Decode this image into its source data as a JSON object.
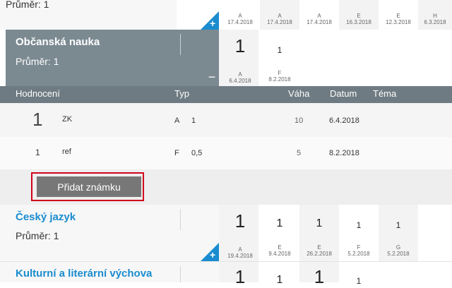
{
  "top_row": {
    "average": "Průměr: 1",
    "grades": [
      {
        "type": "A",
        "date": "17.4.2018"
      },
      {
        "type": "A",
        "date": "17.4.2018"
      },
      {
        "type": "A",
        "date": "17.4.2018"
      },
      {
        "type": "E",
        "date": "16.3.2018"
      },
      {
        "type": "E",
        "date": "12.3.2018"
      },
      {
        "type": "H",
        "date": "6.3.2018"
      }
    ]
  },
  "obcanska": {
    "title": "Občanská nauka",
    "average": "Průměr: 1",
    "grades": [
      {
        "value": "1",
        "type": "A",
        "date": "6.4.2018"
      },
      {
        "value": "1",
        "type": "F",
        "date": "8.2.2018"
      }
    ],
    "minus": "−",
    "table": {
      "headers": {
        "hodnoceni": "Hodnocení",
        "typ": "Typ",
        "vaha": "Váha",
        "datum": "Datum",
        "tema": "Téma"
      },
      "rows": [
        {
          "grade": "1",
          "name": "ZK",
          "type": "A",
          "weight_value": "1",
          "weight": "10",
          "date": "6.4.2018",
          "topic": ""
        },
        {
          "grade": "1",
          "name": "ref",
          "type": "F",
          "weight_value": "0,5",
          "weight": "5",
          "date": "8.2.2018",
          "topic": ""
        }
      ]
    },
    "add_button": "Přidat známku"
  },
  "cesky": {
    "title": "Český jazyk",
    "average": "Průměr: 1",
    "grades": [
      {
        "value": "1",
        "type": "A",
        "date": "19.4.2018"
      },
      {
        "value": "1",
        "type": "E",
        "date": "9.4.2018"
      },
      {
        "value": "1",
        "type": "E",
        "date": "26.2.2018"
      },
      {
        "value": "1",
        "type": "F",
        "date": "5.2.2018"
      },
      {
        "value": "1",
        "type": "G",
        "date": "5.2.2018"
      }
    ]
  },
  "kulturni": {
    "title": "Kulturní a literární výchova",
    "grades": [
      {
        "value": "1"
      },
      {
        "value": "1"
      },
      {
        "value": "1"
      },
      {
        "value": "1"
      }
    ]
  },
  "plus": "+",
  "colors": {
    "header_bg": "#7b8991",
    "table_header_bg": "#6f7b82",
    "accent_blue": "#1a8ccf",
    "highlight_red": "#d0021b",
    "button_bg": "#777777"
  }
}
